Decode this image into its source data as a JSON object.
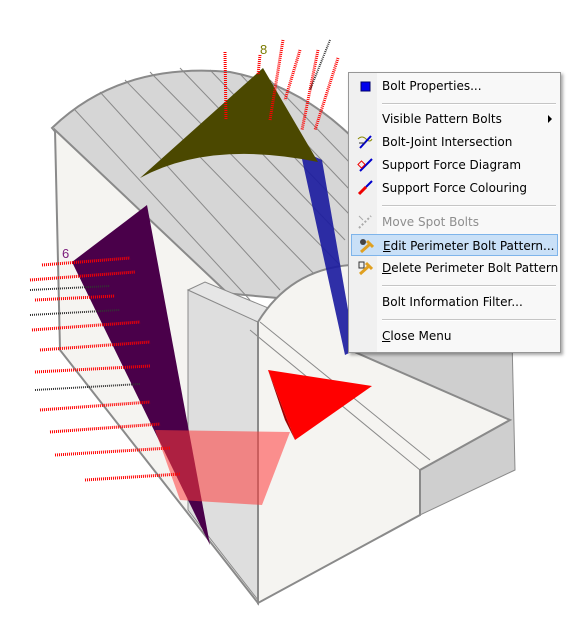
{
  "viewport": {
    "labels": {
      "joint_6": "6",
      "joint_8": "8"
    },
    "colors": {
      "olive_wedge": "#4b4800",
      "purple_wedge": "#4a004a",
      "blue_wedge": "#1a1a9e",
      "red_wedge": "#ff0000",
      "bolts": "#ff0000"
    }
  },
  "menu": {
    "items": [
      {
        "label": "Bolt Properties...",
        "icon": "blue-square-icon"
      },
      {
        "label": "Visible Pattern Bolts",
        "submenu": true
      },
      {
        "label": "Bolt-Joint Intersection",
        "icon": "bolt-joint-icon"
      },
      {
        "label": "Support Force Diagram",
        "icon": "force-diagram-icon"
      },
      {
        "label": "Support Force Colouring",
        "icon": "force-colouring-icon"
      },
      {
        "label": "Move Spot Bolts",
        "icon": "move-bolts-icon",
        "disabled": true
      },
      {
        "mnemonic": "E",
        "rest": "dit Perimeter Bolt Pattern...",
        "icon": "edit-pattern-icon",
        "highlighted": true
      },
      {
        "mnemonic": "D",
        "rest": "elete Perimeter Bolt Pattern",
        "icon": "delete-pattern-icon"
      },
      {
        "label": "Bolt Information Filter..."
      },
      {
        "mnemonic": "C",
        "rest": "lose Menu"
      }
    ]
  }
}
